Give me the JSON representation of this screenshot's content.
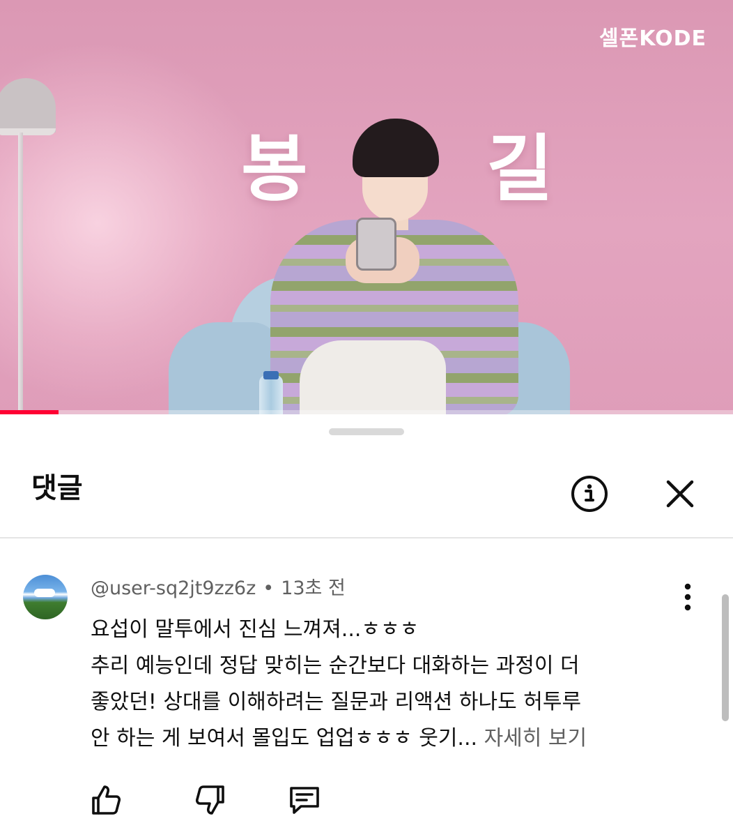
{
  "video": {
    "overlay_caption_left": "봉",
    "overlay_caption_right": "길",
    "channel_logo": "셀폰KODE",
    "progress_fraction": 0.08,
    "accent_color": "#ff0033"
  },
  "comments_panel": {
    "title": "댓글",
    "info_icon": "info-icon",
    "close_icon": "close-icon"
  },
  "comment": {
    "author": "@user-sq2jt9zz6z",
    "separator": "•",
    "time": "13초 전",
    "lines": [
      "요섭이 말투에서 진심 느껴져...ㅎㅎㅎ",
      "추리 예능인데 정답 맞히는 순간보다 대화하는 과정이 더",
      "좋았던! 상대를 이해하려는 질문과 리액션 하나도 허투루",
      "안 하는 게 보여서 몰입도 업업ㅎㅎㅎ 웃기..."
    ],
    "read_more": "자세히 보기",
    "actions": {
      "like_icon": "thumbs-up-icon",
      "dislike_icon": "thumbs-down-icon",
      "reply_icon": "reply-icon",
      "more_icon": "more-vertical-icon"
    }
  }
}
